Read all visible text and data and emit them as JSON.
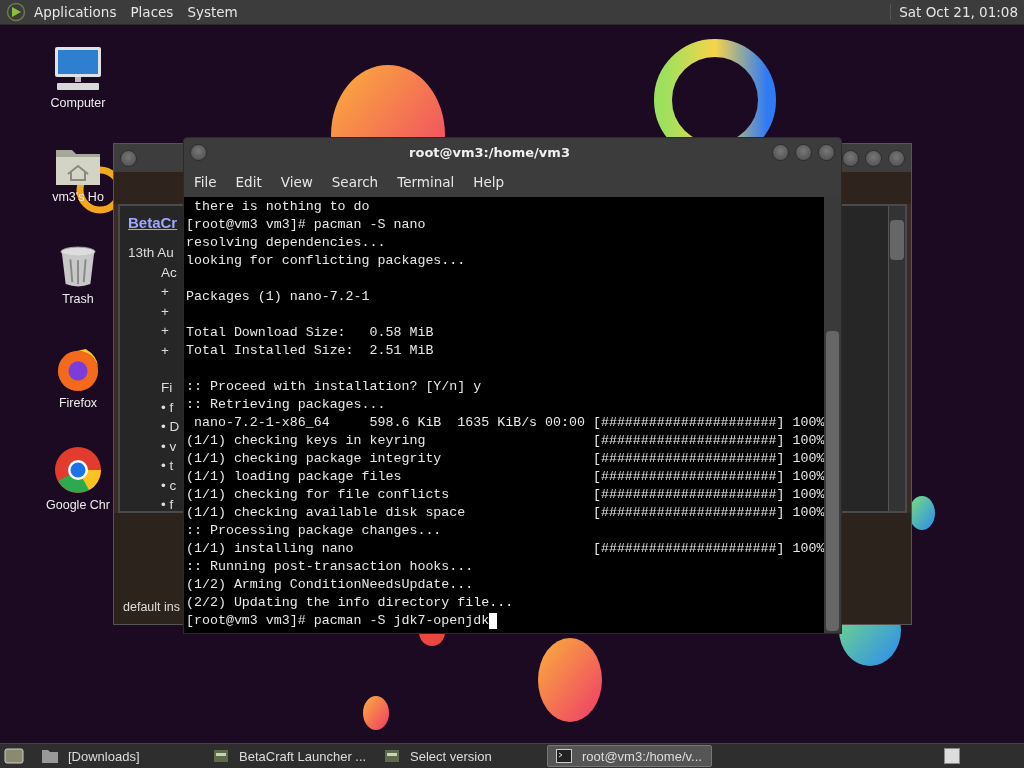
{
  "top_panel": {
    "menus": [
      "Applications",
      "Places",
      "System"
    ],
    "clock": "Sat Oct 21, 01:08"
  },
  "desktop_icons": [
    {
      "kind": "computer",
      "label": "Computer"
    },
    {
      "kind": "home",
      "label": "vm3's Ho"
    },
    {
      "kind": "trash",
      "label": "Trash"
    },
    {
      "kind": "firefox",
      "label": "Firefox"
    },
    {
      "kind": "chrome",
      "label": "Google Chr"
    }
  ],
  "background_window": {
    "link": "BetaCr",
    "date": "13th Au",
    "groups": [
      [
        "Ac",
        "+",
        "+",
        "+",
        "+"
      ],
      [
        "Fi",
        "• f",
        "• D",
        "• v",
        "• t",
        "• c",
        "• f"
      ]
    ],
    "footer": "default ins"
  },
  "terminal": {
    "title": "root@vm3:/home/vm3",
    "menu": [
      "File",
      "Edit",
      "View",
      "Search",
      "Terminal",
      "Help"
    ],
    "blocks": [
      [
        " there is nothing to do",
        "[root@vm3 vm3]# pacman -S nano",
        "resolving dependencies...",
        "looking for conflicting packages..."
      ],
      [
        "Packages (1) nano-7.2-1"
      ],
      [
        "Total Download Size:   0.58 MiB",
        "Total Installed Size:  2.51 MiB"
      ],
      [
        ":: Proceed with installation? [Y/n] y",
        ":: Retrieving packages...",
        " nano-7.2-1-x86_64     598.6 KiB  1635 KiB/s 00:00 [######################] 100%",
        "(1/1) checking keys in keyring                     [######################] 100%",
        "(1/1) checking package integrity                   [######################] 100%",
        "(1/1) loading package files                        [######################] 100%",
        "(1/1) checking for file conflicts                  [######################] 100%",
        "(1/1) checking available disk space                [######################] 100%",
        ":: Processing package changes...",
        "(1/1) installing nano                              [######################] 100%",
        ":: Running post-transaction hooks...",
        "(1/2) Arming ConditionNeedsUpdate...",
        "(2/2) Updating the info directory file...",
        "[root@vm3 vm3]# pacman -S jdk7-openjdk"
      ]
    ]
  },
  "taskbar": {
    "items": [
      {
        "kind": "folder",
        "label": "[Downloads]",
        "selected": false
      },
      {
        "kind": "app",
        "label": "BetaCraft Launcher ...",
        "selected": false
      },
      {
        "kind": "app",
        "label": "Select version",
        "selected": false
      },
      {
        "kind": "terminal",
        "label": "root@vm3:/home/v...",
        "selected": true
      }
    ]
  }
}
